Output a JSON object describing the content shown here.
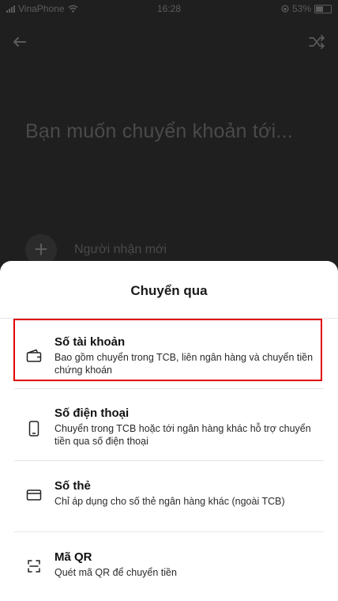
{
  "status_bar": {
    "carrier": "VinaPhone",
    "time": "16:28",
    "battery": "53%"
  },
  "header": {
    "heading": "Bạn muốn chuyển khoản tới...",
    "new_recipient": "Người nhận mới"
  },
  "sheet": {
    "title": "Chuyển qua",
    "options": [
      {
        "icon": "wallet-icon",
        "title": "Số tài khoản",
        "description": "Bao gồm chuyển trong TCB, liên ngân hàng và chuyển tiền chứng khoán"
      },
      {
        "icon": "phone-icon",
        "title": "Số điện thoại",
        "description": "Chuyển trong TCB hoặc tới ngân hàng khác hỗ trợ chuyển tiền qua số điện thoại"
      },
      {
        "icon": "card-icon",
        "title": "Số thẻ",
        "description": "Chỉ áp dụng cho số thẻ ngân hàng khác (ngoài TCB)"
      },
      {
        "icon": "qr-scan-icon",
        "title": "Mã QR",
        "description": "Quét mã QR để chuyển tiền"
      }
    ]
  },
  "colors": {
    "highlight": "#e00000",
    "overlay": "#1f1f1f",
    "sheet": "#ffffff"
  }
}
